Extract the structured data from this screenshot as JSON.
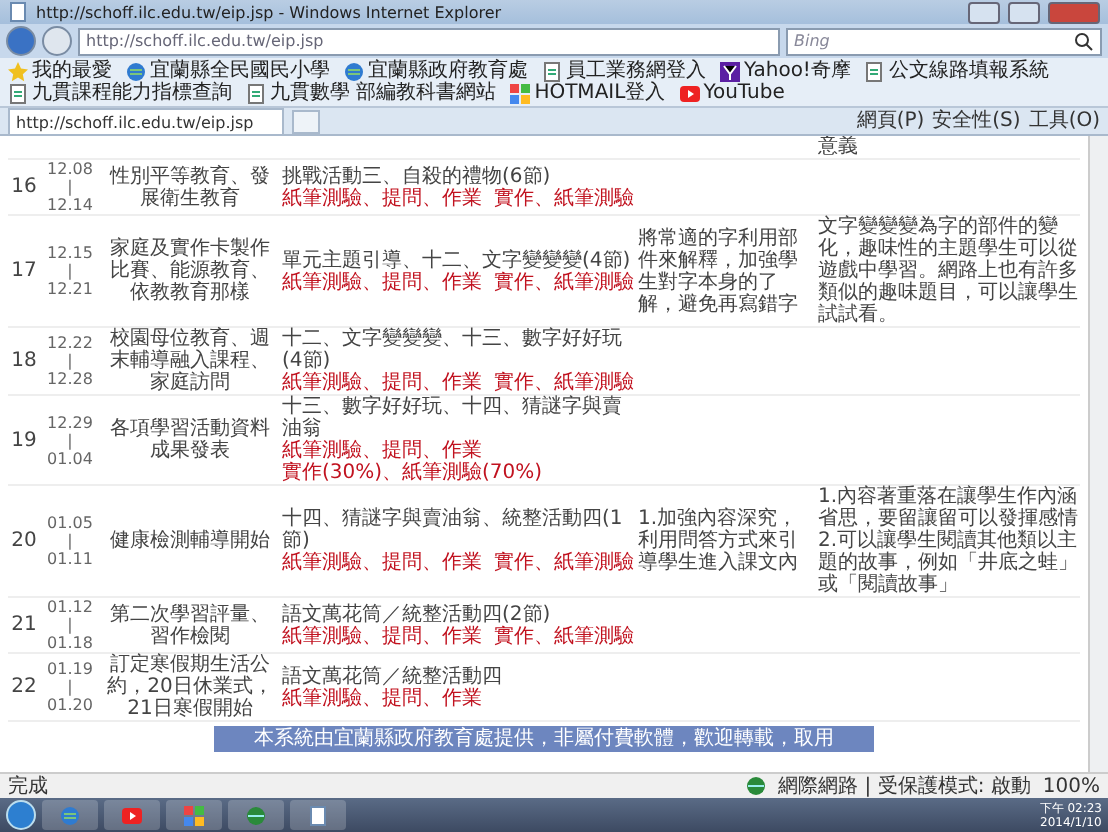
{
  "window": {
    "title": "http://schoff.ilc.edu.tw/eip.jsp - Windows Internet Explorer"
  },
  "address_bar": {
    "url": "http://schoff.ilc.edu.tw/eip.jsp"
  },
  "search": {
    "placeholder": "Bing"
  },
  "favorites_bar": {
    "label": "我的最愛",
    "items": [
      {
        "label": "宜蘭縣全民國民小學",
        "kind": "globe"
      },
      {
        "label": "宜蘭縣政府教育處",
        "kind": "globe"
      },
      {
        "label": "員工業務網登入",
        "kind": "page"
      },
      {
        "label": "Yahoo!奇摩",
        "kind": "yahoo"
      },
      {
        "label": "公文線路填報系統",
        "kind": "page"
      },
      {
        "label": "九貫課程能力指標查詢",
        "kind": "page"
      },
      {
        "label": "九貫數學 部編教科書網站",
        "kind": "page"
      },
      {
        "label": "HOTMAIL登入",
        "kind": "tiles"
      },
      {
        "label": "YouTube",
        "kind": "video"
      }
    ]
  },
  "tabs": [
    {
      "label": "http://schoff.ilc.edu.tw/eip.jsp",
      "selected": true
    }
  ],
  "command_bar": [
    "網頁(P)",
    "安全性(S)",
    "工具(O)"
  ],
  "table": {
    "top_fragment": "意義",
    "rows": [
      {
        "week": "16",
        "date_from": "12.08",
        "date_sep": "|",
        "date_to": "12.14",
        "topic": "性別平等教育、發展衛生教育",
        "content": "挑戰活動三、自殺的禮物(6節)",
        "assessments": [
          "紙筆測驗、提問、作業",
          "實作、紙筆測驗"
        ]
      },
      {
        "week": "17",
        "date_from": "12.15",
        "date_sep": "|",
        "date_to": "12.21",
        "topic": "家庭及實作卡製作比賽、能源教育、依教教育那樣",
        "content": "單元主題引導、十二、文字變變變(4節)",
        "assessments": [
          "紙筆測驗、提問、作業",
          "實作、紙筆測驗"
        ],
        "column_4": "將常適的字利用部件來解釋，加強學生對字本身的了解，避免再寫錯字",
        "column_5": "文字變變變為字的部件的變化，趣味性的主題學生可以從遊戲中學習。網路上也有許多類似的趣味題目，可以讓學生試試看。"
      },
      {
        "week": "18",
        "date_from": "12.22",
        "date_sep": "|",
        "date_to": "12.28",
        "topic": "校園母位教育、週末輔導融入課程、家庭訪問",
        "content": "十二、文字變變變、十三、數字好好玩(4節)",
        "assessments": [
          "紙筆測驗、提問、作業",
          "實作、紙筆測驗"
        ]
      },
      {
        "week": "19",
        "date_from": "12.29",
        "date_sep": "|",
        "date_to": "01.04",
        "topic": "各項學習活動資料成果發表",
        "content": "十三、數字好好玩、十四、猜謎字與賣油翁",
        "assessments": [
          "紙筆測驗、提問、作業",
          "實作(30%)、紙筆測驗(70%)"
        ]
      },
      {
        "week": "20",
        "date_from": "01.05",
        "date_sep": "|",
        "date_to": "01.11",
        "topic": "健康檢測輔導開始",
        "content": "十四、猜謎字與賣油翁、統整活動四(1節)",
        "assessments": [
          "紙筆測驗、提問、作業",
          "實作、紙筆測驗"
        ],
        "column_4": "1.加強內容深究，利用問答方式來引導學生進入課文內",
        "column_5": "1.內容著重落在讓學生作內涵省思，要留讓留可以發揮感情 2.可以讓學生閱讀其他類以主題的故事，例如「井底之蛙」或「閱讀故事」"
      },
      {
        "week": "21",
        "date_from": "01.12",
        "date_sep": "|",
        "date_to": "01.18",
        "topic": "第二次學習評量、習作檢閱",
        "content": "語文萬花筒／統整活動四(2節)",
        "assessments": [
          "紙筆測驗、提問、作業",
          "實作、紙筆測驗"
        ]
      },
      {
        "week": "22",
        "date_from": "01.19",
        "date_sep": "|",
        "date_to": "01.20",
        "topic": "訂定寒假期生活公約，20日休業式，21日寒假開始",
        "content": "語文萬花筒／統整活動四",
        "assessments": [
          "紙筆測驗、提問、作業"
        ]
      }
    ]
  },
  "footer_banner": "本系統由宜蘭縣政府教育處提供，非屬付費軟體，歡迎轉載，取用",
  "status_bar": {
    "status": "完成",
    "zone": "網際網路 | 受保護模式: 啟動",
    "zoom": "100%"
  },
  "taskbar": {
    "time": "下午 02:23",
    "date": "2014/1/10"
  }
}
